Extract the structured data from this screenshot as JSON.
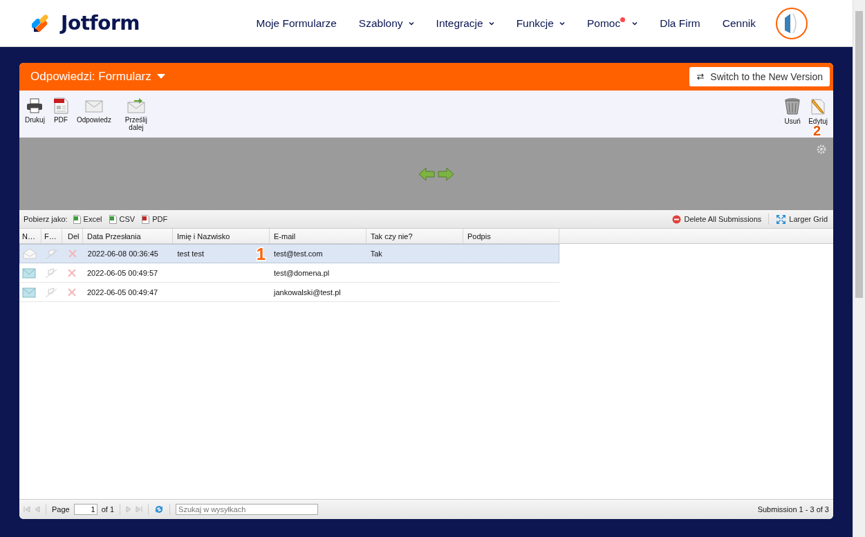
{
  "header": {
    "logo": "Jotform",
    "nav": [
      {
        "label": "Moje Formularze",
        "dropdown": false,
        "dot": false
      },
      {
        "label": "Szablony",
        "dropdown": true,
        "dot": false
      },
      {
        "label": "Integracje",
        "dropdown": true,
        "dot": false
      },
      {
        "label": "Funkcje",
        "dropdown": true,
        "dot": false
      },
      {
        "label": "Pomoc",
        "dropdown": true,
        "dot": true
      },
      {
        "label": "Dla Firm",
        "dropdown": false,
        "dot": false
      },
      {
        "label": "Cennik",
        "dropdown": false,
        "dot": false
      }
    ]
  },
  "panel": {
    "title": "Odpowiedzi: Formularz",
    "switch_button": "Switch to the New Version",
    "toolbar_left": [
      {
        "label": "Drukuj",
        "kind": "print"
      },
      {
        "label": "PDF",
        "kind": "pdf"
      },
      {
        "label": "Odpowiedz",
        "kind": "mail"
      },
      {
        "label": "Prześlij dalej",
        "kind": "forward"
      }
    ],
    "toolbar_right": [
      {
        "label": "Usuń",
        "kind": "trash"
      },
      {
        "label": "Edytuj",
        "kind": "edit"
      }
    ],
    "callout_toolbar": "2",
    "download": {
      "label": "Pobierz jako:",
      "formats": [
        {
          "label": "Excel",
          "kind": "excel"
        },
        {
          "label": "CSV",
          "kind": "csv"
        },
        {
          "label": "PDF",
          "kind": "pdf"
        }
      ],
      "delete_all": "Delete All Submissions",
      "larger_grid": "Larger Grid"
    },
    "table": {
      "columns": [
        "N…",
        "F…",
        "Del",
        "Data Przesłania",
        "Imię i Nazwisko",
        "E-mail",
        "Tak czy nie?",
        "Podpis"
      ],
      "callout": "1",
      "rows": [
        {
          "selected": true,
          "read": true,
          "date": "2022-06-08 00:36:45",
          "name": "test test",
          "email": "test@test.com",
          "answer": "Tak"
        },
        {
          "selected": false,
          "read": false,
          "date": "2022-06-05 00:49:57",
          "email": "test@domena.pl"
        },
        {
          "selected": false,
          "read": false,
          "date": "2022-06-05 00:49:47",
          "email": "jankowalski@test.pl"
        }
      ]
    },
    "pager": {
      "page_label": "Page",
      "page": "1",
      "of": "of 1",
      "search_placeholder": "Szukaj w wysyłkach",
      "summary": "Submission 1 - 3 of 3"
    }
  }
}
